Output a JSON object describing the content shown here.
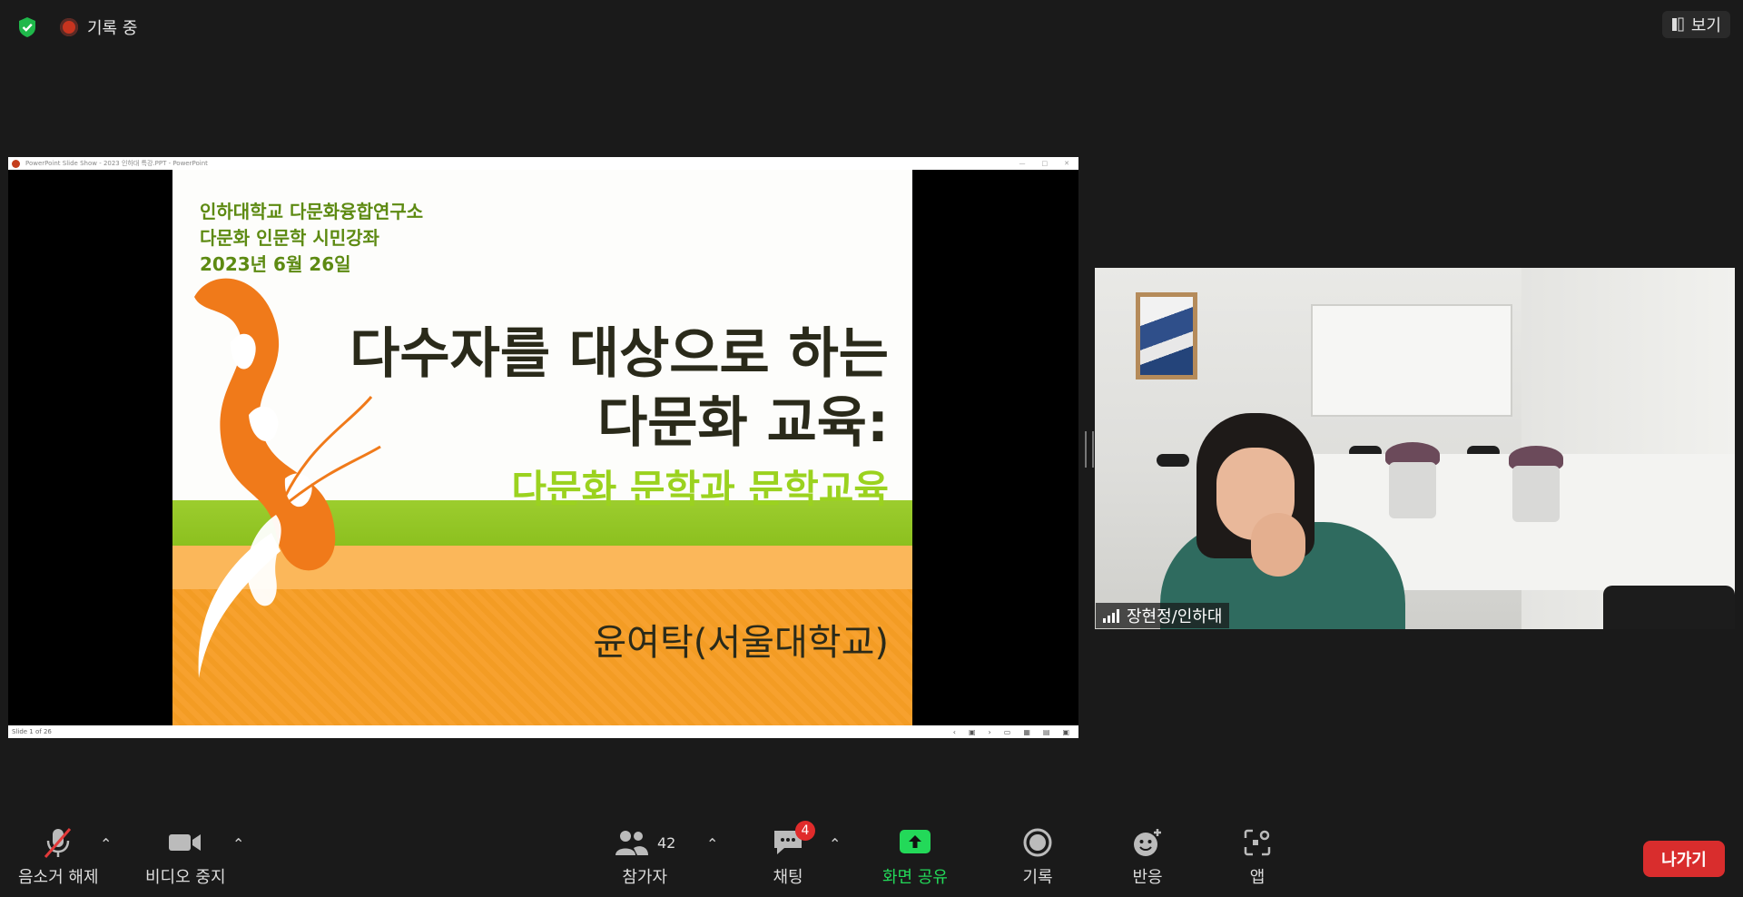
{
  "topbar": {
    "recording_label": "기록 중",
    "view_label": "보기"
  },
  "share": {
    "ppt_title": "PowerPoint Slide Show - 2023 인하대 특강.PPT - PowerPoint",
    "status_text": "Slide 1 of 26"
  },
  "slide": {
    "org_lines": [
      "인하대학교 다문화융합연구소",
      "다문화 인문학 시민강좌",
      "2023년 6월 26일"
    ],
    "title_lines": [
      "다수자를 대상으로 하는",
      "다문화 교육:"
    ],
    "subtitle": "다문화 문학과 문학교육",
    "author": "윤여탁(서울대학교)"
  },
  "video": {
    "participant_name": "장현정/인하대"
  },
  "toolbar": {
    "mute_label": "음소거 해제",
    "video_label": "비디오 중지",
    "participants_label": "참가자",
    "participants_count": "42",
    "chat_label": "채팅",
    "chat_badge": "4",
    "share_label": "화면 공유",
    "record_label": "기록",
    "reactions_label": "반응",
    "apps_label": "앱",
    "leave_label": "나가기"
  },
  "colors": {
    "share_accent": "#23d959",
    "leave": "#d92d2d",
    "shield": "#1fb84a"
  }
}
